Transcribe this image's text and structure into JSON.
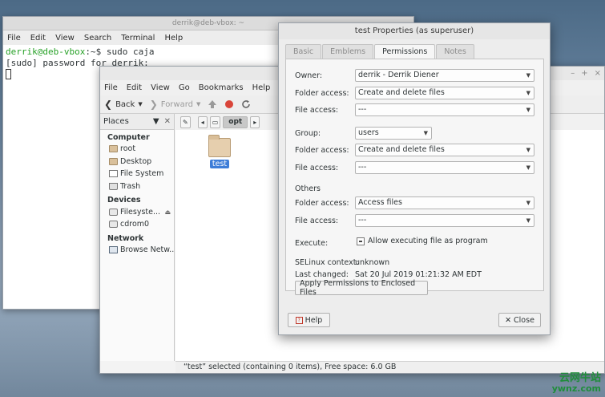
{
  "terminal": {
    "title": "derrik@deb-vbox: ~",
    "menu": [
      "File",
      "Edit",
      "View",
      "Search",
      "Terminal",
      "Help"
    ],
    "prompt_user": "derrik@deb-vbox",
    "prompt_path": ":~$ ",
    "command": "sudo caja",
    "output": "[sudo] password for derrik:"
  },
  "caja": {
    "window_controls": [
      "–",
      "+",
      "×"
    ],
    "menu": [
      "File",
      "Edit",
      "View",
      "Go",
      "Bookmarks",
      "Help"
    ],
    "toolbar": {
      "back": "Back",
      "forward": "Forward"
    },
    "sidebar": {
      "header": "Places",
      "sections": {
        "computer": "Computer",
        "devices": "Devices",
        "network": "Network"
      },
      "computer_items": [
        "root",
        "Desktop",
        "File System",
        "Trash"
      ],
      "device_items": [
        "Filesyste...",
        "cdrom0"
      ],
      "network_items": [
        "Browse Netw..."
      ]
    },
    "pathbar": {
      "current": "opt"
    },
    "file": {
      "name": "test"
    },
    "status": "“test” selected (containing 0 items), Free space: 6.0 GB"
  },
  "dialog": {
    "title": "test Properties (as superuser)",
    "tabs": [
      "Basic",
      "Emblems",
      "Permissions",
      "Notes"
    ],
    "active_tab": "Permissions",
    "owner_label": "Owner:",
    "owner_value": "derrik - Derrik Diener",
    "owner_folder_access_label": "Folder access:",
    "owner_folder_access_value": "Create and delete files",
    "owner_file_access_label": "File access:",
    "owner_file_access_value": "---",
    "group_label": "Group:",
    "group_value": "users",
    "group_folder_access_label": "Folder access:",
    "group_folder_access_value": "Create and delete files",
    "group_file_access_label": "File access:",
    "group_file_access_value": "---",
    "others_label": "Others",
    "others_folder_access_label": "Folder access:",
    "others_folder_access_value": "Access files",
    "others_file_access_label": "File access:",
    "others_file_access_value": "---",
    "execute_label": "Execute:",
    "execute_checkbox": "Allow executing file as program",
    "selinux_label": "SELinux context:",
    "selinux_value": "unknown",
    "last_changed_label": "Last changed:",
    "last_changed_value": "Sat 20 Jul 2019 01:21:32 AM EDT",
    "apply_button": "Apply Permissions to Enclosed Files",
    "help_button": "Help",
    "close_button": "Close"
  },
  "watermark": {
    "cn": "云网牛站",
    "en": "ywnz.com"
  }
}
